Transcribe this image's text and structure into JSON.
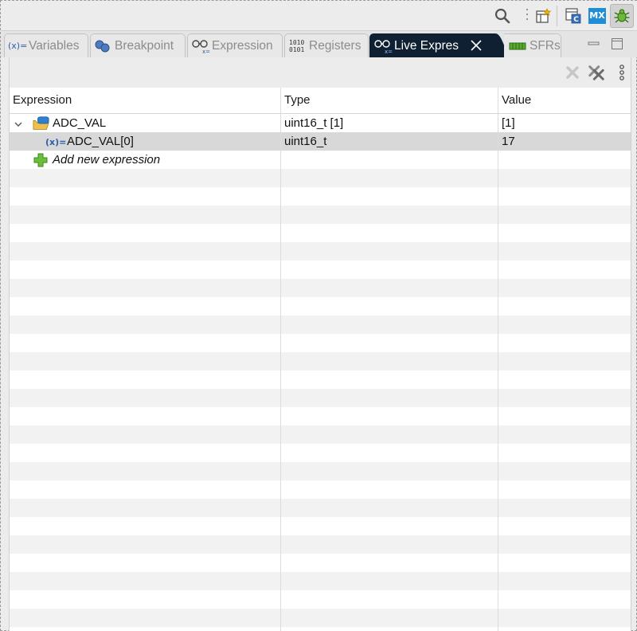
{
  "toolbar": {
    "icons": [
      "search-icon",
      "open-perspective-icon",
      "c-cpp-perspective-icon",
      "mx-perspective-icon",
      "debug-perspective-icon"
    ],
    "mx_label": "MX"
  },
  "tabs": [
    {
      "label": "Variables",
      "icon": "variables-icon",
      "icon_text": "(x)="
    },
    {
      "label": "Breakpoint",
      "icon": "breakpoints-icon"
    },
    {
      "label": "Expression",
      "icon": "expressions-icon"
    },
    {
      "label": "Registers",
      "icon": "registers-icon",
      "icon_text": "1010 0101"
    },
    {
      "label": "Live Expres",
      "icon": "live-expressions-icon",
      "active": true
    },
    {
      "label": "SFRs",
      "icon": "sfrs-icon"
    }
  ],
  "view_toolbar": {
    "icons": [
      "remove-expression-icon",
      "remove-all-expressions-icon",
      "view-menu-icon"
    ]
  },
  "table": {
    "columns": [
      "Expression",
      "Type",
      "Value"
    ],
    "rows": [
      {
        "expression": "ADC_VAL",
        "type": "uint16_t [1]",
        "value": "[1]",
        "icon": "struct-icon",
        "expanded": true
      },
      {
        "expression": "ADC_VAL[0]",
        "type": "uint16_t",
        "value": "17",
        "icon": "variable-icon",
        "icon_text": "(x)=",
        "selected": true
      },
      {
        "expression": "Add new expression",
        "type": "",
        "value": "",
        "icon": "add-icon"
      }
    ]
  },
  "colors": {
    "active_tab": "#0f2033",
    "alt_row": "#f2f2f2",
    "selected_row": "#d8d8d8",
    "add_green": "#5aa832",
    "accent_blue": "#2d7fd0"
  }
}
